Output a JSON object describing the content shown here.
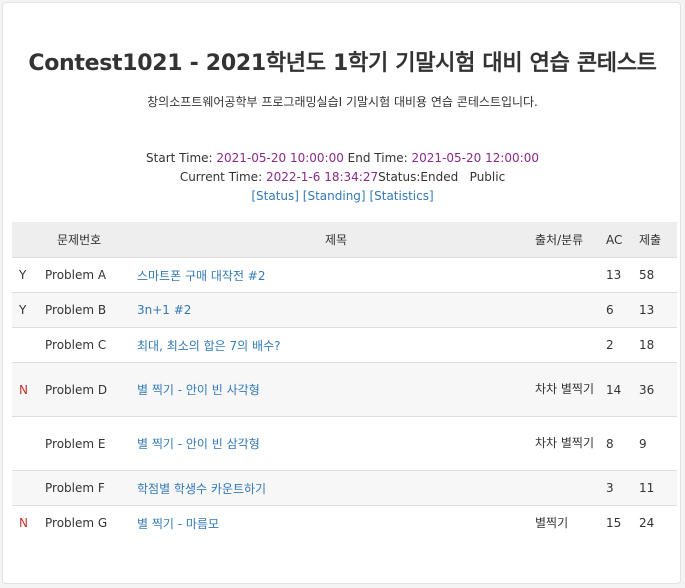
{
  "contest": {
    "title": "Contest1021 - 2021학년도 1학기 기말시험 대비 연습 콘테스트",
    "description": "창의소프트웨어공학부 프로그래밍실습I 기말시험 대비용 연습 콘테스트입니다."
  },
  "info": {
    "start_label": "Start Time:",
    "start_value": "2021-05-20 10:00:00",
    "end_label": "End Time:",
    "end_value": "2021-05-20 12:00:00",
    "current_label": "Current Time:",
    "current_value": "2022-1-6 18:34:27",
    "status_label": "Status:",
    "status_value": "Ended",
    "visibility": "Public",
    "links": {
      "status": "[Status]",
      "standing": "[Standing]",
      "statistics": "[Statistics]"
    }
  },
  "table": {
    "headers": {
      "status": "",
      "pid": "문제번호",
      "title": "제목",
      "source": "출처/분류",
      "ac": "AC",
      "submit": "제출"
    },
    "rows": [
      {
        "status": "Y",
        "pid": "Problem  A",
        "title": "스마트폰 구매 대작전 #2",
        "source": "",
        "ac": "13",
        "submit": "58"
      },
      {
        "status": "Y",
        "pid": "Problem  B",
        "title": "3n+1 #2",
        "source": "",
        "ac": "6",
        "submit": "13"
      },
      {
        "status": "",
        "pid": "Problem  C",
        "title": "최대, 최소의 합은 7의 배수?",
        "source": "",
        "ac": "2",
        "submit": "18"
      },
      {
        "status": "N",
        "pid": "Problem  D",
        "title": "별 찍기 - 안이 빈 사각형",
        "source": "차차 별찍기",
        "ac": "14",
        "submit": "36"
      },
      {
        "status": "",
        "pid": "Problem  E",
        "title": "별 찍기 - 안이 빈 삼각형",
        "source": "차차 별찍기",
        "ac": "8",
        "submit": "9"
      },
      {
        "status": "",
        "pid": "Problem  F",
        "title": "학점별 학생수 카운트하기",
        "source": "",
        "ac": "3",
        "submit": "11"
      },
      {
        "status": "N",
        "pid": "Problem  G",
        "title": "별 찍기 - 마름모",
        "source": "별찍기",
        "ac": "15",
        "submit": "24"
      }
    ]
  },
  "colors": {
    "link": "#3379b7",
    "time_value": "#8a2a8a",
    "status_no": "#c9302c"
  }
}
